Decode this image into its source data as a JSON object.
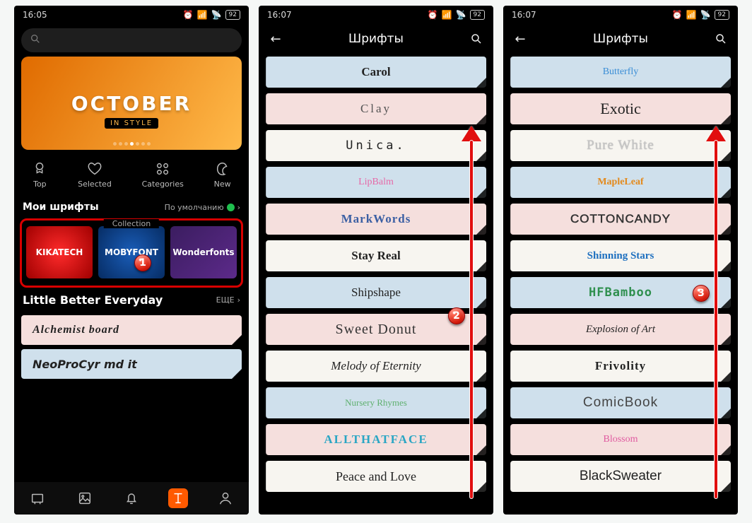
{
  "status_times": [
    "16:05",
    "16:07",
    "16:07"
  ],
  "battery": "92",
  "screen1": {
    "hero_title": "OCTOBER",
    "hero_sub": "IN STYLE",
    "tabs": {
      "top": "Top",
      "selected": "Selected",
      "categories": "Categories",
      "new": "New"
    },
    "sec1_title": "Мои шрифты",
    "sec1_right": "По умолчанию",
    "collection_label": "Collection",
    "coll1": "KIKATECH",
    "coll2": "MOBYFONT",
    "coll3": "Wonderfonts",
    "sec2_title": "Little Better Everyday",
    "sec2_more": "ЕЩЕ",
    "preview1": "Alchemist board",
    "preview2": "NeoProCyr md it"
  },
  "screen2": {
    "title": "Шрифты",
    "fonts": [
      "Carol",
      "Clay",
      "Unica.",
      "LipBalm",
      "MarkWords",
      "Stay Real",
      "Shipshape",
      "Sweet Donut",
      "Melody of Eternity",
      "Nursery Rhymes",
      "ALLTHATFACE",
      "Peace and Love"
    ]
  },
  "screen3": {
    "title": "Шрифты",
    "fonts": [
      "Butterfly",
      "Exotic",
      "Pure White",
      "MapleLeaf",
      "COTTONCANDY",
      "Shinning Stars",
      "HFBamboo",
      "Explosion of Art",
      "Frivolity",
      "ComicBook",
      "Blossom",
      "BlackSweater"
    ]
  },
  "badges": {
    "b1": "1",
    "b2": "2",
    "b3": "3"
  }
}
